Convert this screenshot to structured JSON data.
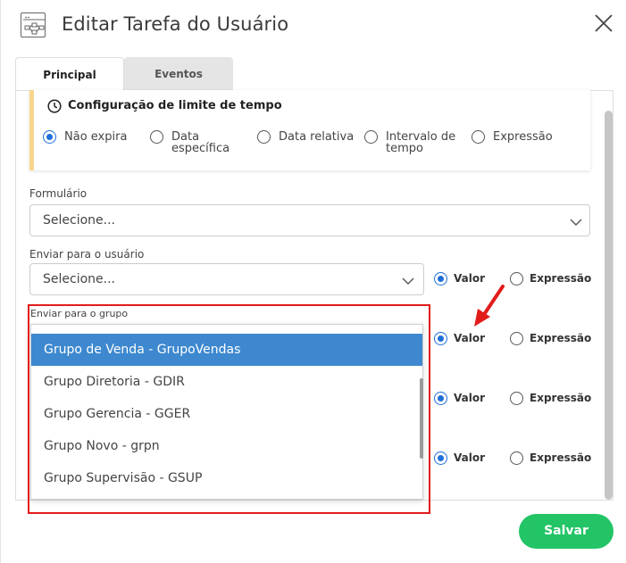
{
  "header": {
    "title": "Editar Tarefa do Usuário"
  },
  "tabs": [
    {
      "label": "Principal",
      "active": true
    },
    {
      "label": "Eventos",
      "active": false
    }
  ],
  "time_config": {
    "title": "Configuração de limite de tempo",
    "options": [
      {
        "label": "Não expira",
        "checked": true
      },
      {
        "label_line1": "Data",
        "label_line2": "específica",
        "checked": false
      },
      {
        "label": "Data relativa",
        "checked": false
      },
      {
        "label_line1": "Intervalo de",
        "label_line2": "tempo",
        "checked": false
      },
      {
        "label": "Expressão",
        "checked": false
      }
    ]
  },
  "formulario": {
    "label": "Formulário",
    "value": "Selecione..."
  },
  "enviar_usuario": {
    "label": "Enviar para o usuário",
    "value": "Selecione..."
  },
  "enviar_grupo": {
    "label": "Enviar para o grupo"
  },
  "mode_labels": {
    "valor": "Valor",
    "expressao": "Expressão"
  },
  "group_options": [
    {
      "label": "Grupo de Venda - GrupoVendas",
      "selected": true
    },
    {
      "label": "Grupo Diretoria - GDIR",
      "selected": false
    },
    {
      "label": "Grupo Gerencia - GGER",
      "selected": false
    },
    {
      "label": "Grupo Novo - grpn",
      "selected": false
    },
    {
      "label": "Grupo Supervisão - GSUP",
      "selected": false
    }
  ],
  "footer": {
    "save_label": "Salvar"
  },
  "colors": {
    "accent": "#1e6fd9",
    "save": "#22c466",
    "highlight": "#e21b1b",
    "selected_row": "#3d88cf",
    "card_border": "#f8d68e"
  }
}
